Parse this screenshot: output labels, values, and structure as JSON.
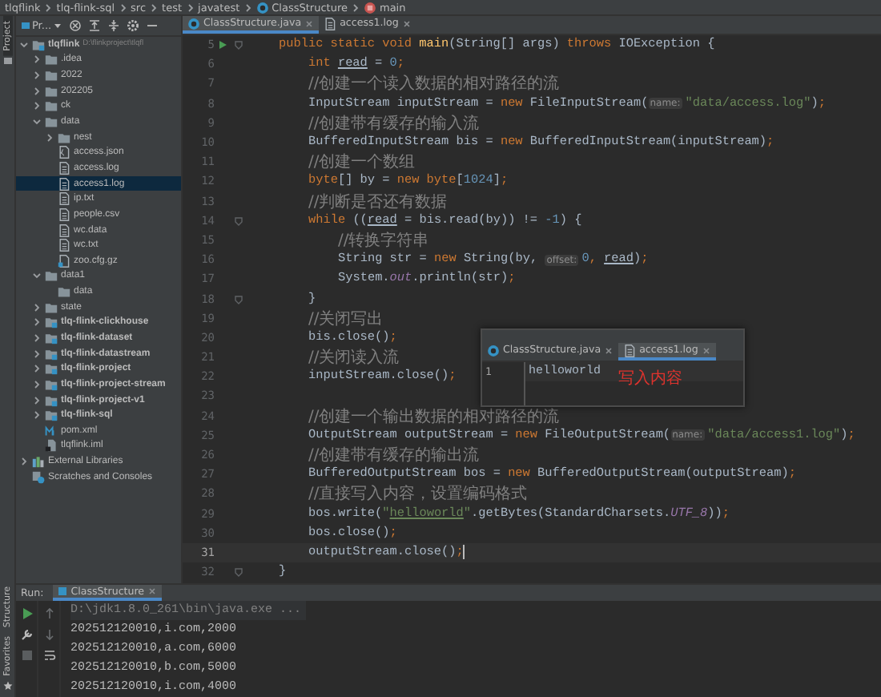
{
  "breadcrumbs": [
    {
      "label": "tlqflink",
      "kind": "folder"
    },
    {
      "label": "tlq-flink-sql",
      "kind": "folder"
    },
    {
      "label": "src",
      "kind": "folder"
    },
    {
      "label": "test",
      "kind": "folder"
    },
    {
      "label": "javatest",
      "kind": "folder"
    },
    {
      "label": "ClassStructure",
      "kind": "class"
    },
    {
      "label": "main",
      "kind": "method"
    }
  ],
  "tool_stripe_top": [
    {
      "label": "Project",
      "selected": true
    }
  ],
  "tool_stripe_bottom": [
    {
      "label": "Structure",
      "selected": false
    },
    {
      "label": "Favorites",
      "selected": false
    }
  ],
  "project": {
    "view": "Pr...",
    "tree": [
      {
        "label": "tlqflink",
        "path": "D:\\flinkproject\\tlqfl",
        "kind": "module",
        "expanded": true,
        "selected": false,
        "children": [
          {
            "label": ".idea",
            "kind": "folder",
            "expanded": false,
            "selected": false
          },
          {
            "label": "2022",
            "kind": "folder",
            "expanded": false,
            "selected": false
          },
          {
            "label": "202205",
            "kind": "folder",
            "expanded": false,
            "selected": false
          },
          {
            "label": "ck",
            "kind": "folder",
            "expanded": false,
            "selected": false
          },
          {
            "label": "data",
            "kind": "folder",
            "expanded": true,
            "selected": false,
            "children": [
              {
                "label": "nest",
                "kind": "folder",
                "expanded": false,
                "selected": false
              },
              {
                "label": "access.json",
                "kind": "json",
                "selected": false
              },
              {
                "label": "access.log",
                "kind": "file",
                "selected": false
              },
              {
                "label": "access1.log",
                "kind": "file",
                "selected": true
              },
              {
                "label": "ip.txt",
                "kind": "file",
                "selected": false
              },
              {
                "label": "people.csv",
                "kind": "file",
                "selected": false
              },
              {
                "label": "wc.data",
                "kind": "file",
                "selected": false
              },
              {
                "label": "wc.txt",
                "kind": "file",
                "selected": false
              },
              {
                "label": "zoo.cfg.gz",
                "kind": "archive",
                "selected": false
              }
            ]
          },
          {
            "label": "data1",
            "kind": "folder",
            "expanded": true,
            "selected": false,
            "children": [
              {
                "label": "data",
                "kind": "folder",
                "selected": false
              }
            ]
          },
          {
            "label": "state",
            "kind": "folder",
            "expanded": false,
            "selected": false
          },
          {
            "label": "tlq-flink-clickhouse",
            "kind": "module",
            "expanded": false,
            "selected": false
          },
          {
            "label": "tlq-flink-dataset",
            "kind": "module",
            "expanded": false,
            "selected": false
          },
          {
            "label": "tlq-flink-datastream",
            "kind": "module",
            "expanded": false,
            "selected": false
          },
          {
            "label": "tlq-flink-project",
            "kind": "module",
            "expanded": false,
            "selected": false
          },
          {
            "label": "tlq-flink-project-stream",
            "kind": "module",
            "expanded": false,
            "selected": false
          },
          {
            "label": "tlq-flink-project-v1",
            "kind": "module",
            "expanded": false,
            "selected": false
          },
          {
            "label": "tlq-flink-sql",
            "kind": "module",
            "expanded": false,
            "selected": false
          },
          {
            "label": "pom.xml",
            "kind": "maven",
            "selected": false
          },
          {
            "label": "tlqflink.iml",
            "kind": "iml",
            "selected": false
          }
        ]
      },
      {
        "label": "External Libraries",
        "kind": "library",
        "expanded": false,
        "selected": false
      },
      {
        "label": "Scratches and Consoles",
        "kind": "scratches",
        "selected": false
      }
    ]
  },
  "editor_tabs": [
    {
      "label": "ClassStructure.java",
      "kind": "class",
      "selected": true
    },
    {
      "label": "access1.log",
      "kind": "file",
      "selected": false
    }
  ],
  "code": [
    {
      "number": "5",
      "kind": "member",
      "run": true,
      "fold": true,
      "current": false,
      "segments": [
        {
          "kind": "keyword",
          "text": "public static void "
        },
        {
          "kind": "method",
          "text": "main"
        },
        {
          "kind": "plain",
          "text": "(String[] args) "
        },
        {
          "kind": "keyword",
          "text": "throws "
        },
        {
          "kind": "plain",
          "text": "IOException {"
        }
      ]
    },
    {
      "number": "6",
      "kind": "statement",
      "run": false,
      "fold": false,
      "current": false,
      "segments": [
        {
          "kind": "keyword",
          "text": "int "
        },
        {
          "kind": "variable",
          "text": "read"
        },
        {
          "kind": "plain",
          "text": " = "
        },
        {
          "kind": "number",
          "text": "0"
        },
        {
          "kind": "keyword",
          "text": ";"
        }
      ]
    },
    {
      "number": "7",
      "kind": "statement",
      "run": false,
      "fold": false,
      "current": false,
      "segments": [
        {
          "kind": "comment",
          "text": "//创建一个读入数据的相对路径的流"
        }
      ]
    },
    {
      "number": "8",
      "kind": "statement",
      "run": false,
      "fold": false,
      "current": false,
      "segments": [
        {
          "kind": "plain",
          "text": "InputStream inputStream = "
        },
        {
          "kind": "keyword",
          "text": "new "
        },
        {
          "kind": "plain",
          "text": "FileInputStream("
        },
        {
          "kind": "hint",
          "text": "name:"
        },
        {
          "kind": "string",
          "text": "\"data/access.log\""
        },
        {
          "kind": "plain",
          "text": ")"
        },
        {
          "kind": "keyword",
          "text": ";"
        }
      ]
    },
    {
      "number": "9",
      "kind": "statement",
      "run": false,
      "fold": false,
      "current": false,
      "segments": [
        {
          "kind": "comment",
          "text": "//创建带有缓存的输入流"
        }
      ]
    },
    {
      "number": "10",
      "kind": "statement",
      "run": false,
      "fold": false,
      "current": false,
      "segments": [
        {
          "kind": "plain",
          "text": "BufferedInputStream bis = "
        },
        {
          "kind": "keyword",
          "text": "new "
        },
        {
          "kind": "plain",
          "text": "BufferedInputStream(inputStream)"
        },
        {
          "kind": "keyword",
          "text": ";"
        }
      ]
    },
    {
      "number": "11",
      "kind": "statement",
      "run": false,
      "fold": false,
      "current": false,
      "segments": [
        {
          "kind": "comment",
          "text": "//创建一个数组"
        }
      ]
    },
    {
      "number": "12",
      "kind": "statement",
      "run": false,
      "fold": false,
      "current": false,
      "segments": [
        {
          "kind": "keyword",
          "text": "byte"
        },
        {
          "kind": "plain",
          "text": "[] by = "
        },
        {
          "kind": "keyword",
          "text": "new byte"
        },
        {
          "kind": "plain",
          "text": "["
        },
        {
          "kind": "number",
          "text": "1024"
        },
        {
          "kind": "plain",
          "text": "]"
        },
        {
          "kind": "keyword",
          "text": ";"
        }
      ]
    },
    {
      "number": "13",
      "kind": "statement",
      "run": false,
      "fold": false,
      "current": false,
      "segments": [
        {
          "kind": "comment",
          "text": "//判断是否还有数据"
        }
      ]
    },
    {
      "number": "14",
      "kind": "statement",
      "run": false,
      "fold": true,
      "current": false,
      "segments": [
        {
          "kind": "keyword",
          "text": "while "
        },
        {
          "kind": "plain",
          "text": "(("
        },
        {
          "kind": "variable",
          "text": "read"
        },
        {
          "kind": "plain",
          "text": " = bis.read(by)) != "
        },
        {
          "kind": "number",
          "text": "-1"
        },
        {
          "kind": "plain",
          "text": ") {"
        }
      ]
    },
    {
      "number": "15",
      "kind": "nested",
      "run": false,
      "fold": false,
      "current": false,
      "segments": [
        {
          "kind": "comment",
          "text": "//转换字符串"
        }
      ]
    },
    {
      "number": "16",
      "kind": "nested",
      "run": false,
      "fold": false,
      "current": false,
      "segments": [
        {
          "kind": "plain",
          "text": "String str = "
        },
        {
          "kind": "keyword",
          "text": "new "
        },
        {
          "kind": "plain",
          "text": "String(by, "
        },
        {
          "kind": "hint",
          "text": "offset:"
        },
        {
          "kind": "number",
          "text": "0"
        },
        {
          "kind": "keyword",
          "text": ", "
        },
        {
          "kind": "variable",
          "text": "read"
        },
        {
          "kind": "plain",
          "text": ")"
        },
        {
          "kind": "keyword",
          "text": ";"
        }
      ]
    },
    {
      "number": "17",
      "kind": "nested",
      "run": false,
      "fold": false,
      "current": false,
      "segments": [
        {
          "kind": "plain",
          "text": "System."
        },
        {
          "kind": "field",
          "text": "out"
        },
        {
          "kind": "plain",
          "text": ".println(str)"
        },
        {
          "kind": "keyword",
          "text": ";"
        }
      ]
    },
    {
      "number": "18",
      "kind": "statement",
      "run": false,
      "fold": true,
      "current": false,
      "segments": [
        {
          "kind": "plain",
          "text": "}"
        }
      ]
    },
    {
      "number": "19",
      "kind": "statement",
      "run": false,
      "fold": false,
      "current": false,
      "segments": [
        {
          "kind": "comment",
          "text": "//关闭写出"
        }
      ]
    },
    {
      "number": "20",
      "kind": "statement",
      "run": false,
      "fold": false,
      "current": false,
      "segments": [
        {
          "kind": "plain",
          "text": "bis.close()"
        },
        {
          "kind": "keyword",
          "text": ";"
        }
      ]
    },
    {
      "number": "21",
      "kind": "statement",
      "run": false,
      "fold": false,
      "current": false,
      "segments": [
        {
          "kind": "comment",
          "text": "//关闭读入流"
        }
      ]
    },
    {
      "number": "22",
      "kind": "statement",
      "run": false,
      "fold": false,
      "current": false,
      "segments": [
        {
          "kind": "plain",
          "text": "inputStream.close()"
        },
        {
          "kind": "keyword",
          "text": ";"
        }
      ]
    },
    {
      "number": "23",
      "kind": "statement",
      "run": false,
      "fold": false,
      "current": false
    },
    {
      "number": "24",
      "kind": "statement",
      "run": false,
      "fold": false,
      "current": false,
      "segments": [
        {
          "kind": "comment",
          "text": "//创建一个输出数据的相对路径的流"
        }
      ]
    },
    {
      "number": "25",
      "kind": "statement",
      "run": false,
      "fold": false,
      "current": false,
      "segments": [
        {
          "kind": "plain",
          "text": "OutputStream outputStream = "
        },
        {
          "kind": "keyword",
          "text": "new "
        },
        {
          "kind": "plain",
          "text": "FileOutputStream("
        },
        {
          "kind": "hint",
          "text": "name:"
        },
        {
          "kind": "string",
          "text": "\"data/access1.log\""
        },
        {
          "kind": "plain",
          "text": ")"
        },
        {
          "kind": "keyword",
          "text": ";"
        }
      ]
    },
    {
      "number": "26",
      "kind": "statement",
      "run": false,
      "fold": false,
      "current": false,
      "segments": [
        {
          "kind": "comment",
          "text": "//创建带有缓存的输出流"
        }
      ]
    },
    {
      "number": "27",
      "kind": "statement",
      "run": false,
      "fold": false,
      "current": false,
      "segments": [
        {
          "kind": "plain",
          "text": "BufferedOutputStream bos = "
        },
        {
          "kind": "keyword",
          "text": "new "
        },
        {
          "kind": "plain",
          "text": "BufferedOutputStream(outputStream)"
        },
        {
          "kind": "keyword",
          "text": ";"
        }
      ]
    },
    {
      "number": "28",
      "kind": "statement",
      "run": false,
      "fold": false,
      "current": false,
      "segments": [
        {
          "kind": "comment",
          "text": "//直接写入内容，设置编码格式"
        }
      ]
    },
    {
      "number": "29",
      "kind": "statement",
      "run": false,
      "fold": false,
      "current": false,
      "segments": [
        {
          "kind": "plain",
          "text": "bos.write("
        },
        {
          "kind": "string",
          "text": "\""
        },
        {
          "kind": "spelling",
          "text": "helloworld"
        },
        {
          "kind": "string",
          "text": "\""
        },
        {
          "kind": "plain",
          "text": ".getBytes(StandardCharsets."
        },
        {
          "kind": "field",
          "text": "UTF_8"
        },
        {
          "kind": "plain",
          "text": "))"
        },
        {
          "kind": "keyword",
          "text": ";"
        }
      ]
    },
    {
      "number": "30",
      "kind": "statement",
      "run": false,
      "fold": false,
      "current": false,
      "segments": [
        {
          "kind": "plain",
          "text": "bos.close()"
        },
        {
          "kind": "keyword",
          "text": ";"
        }
      ]
    },
    {
      "number": "31",
      "kind": "statement",
      "run": false,
      "fold": false,
      "current": true,
      "segments": [
        {
          "kind": "plain",
          "text": "outputStream.close()"
        },
        {
          "kind": "keyword",
          "text": ";"
        }
      ]
    },
    {
      "number": "32",
      "kind": "member",
      "run": false,
      "fold": true,
      "current": false,
      "segments": [
        {
          "kind": "plain",
          "text": "}"
        }
      ]
    }
  ],
  "popup": {
    "tabs": [
      {
        "label": "ClassStructure.java",
        "kind": "class",
        "selected": false
      },
      {
        "label": "access1.log",
        "kind": "file",
        "selected": true
      }
    ],
    "line_number": "1",
    "content": "helloworld",
    "note": "写入内容"
  },
  "run": {
    "label": "Run:",
    "tab": "ClassStructure",
    "output": [
      {
        "kind": "command",
        "text": "D:\\jdk1.8.0_261\\bin\\java.exe ..."
      },
      {
        "kind": "stdout",
        "text": "202512120010,i.com,2000"
      },
      {
        "kind": "stdout",
        "text": "202512120010,a.com,6000"
      },
      {
        "kind": "stdout",
        "text": "202512120010,b.com,5000"
      },
      {
        "kind": "stdout",
        "text": "202512120010,i.com,4000"
      }
    ]
  }
}
